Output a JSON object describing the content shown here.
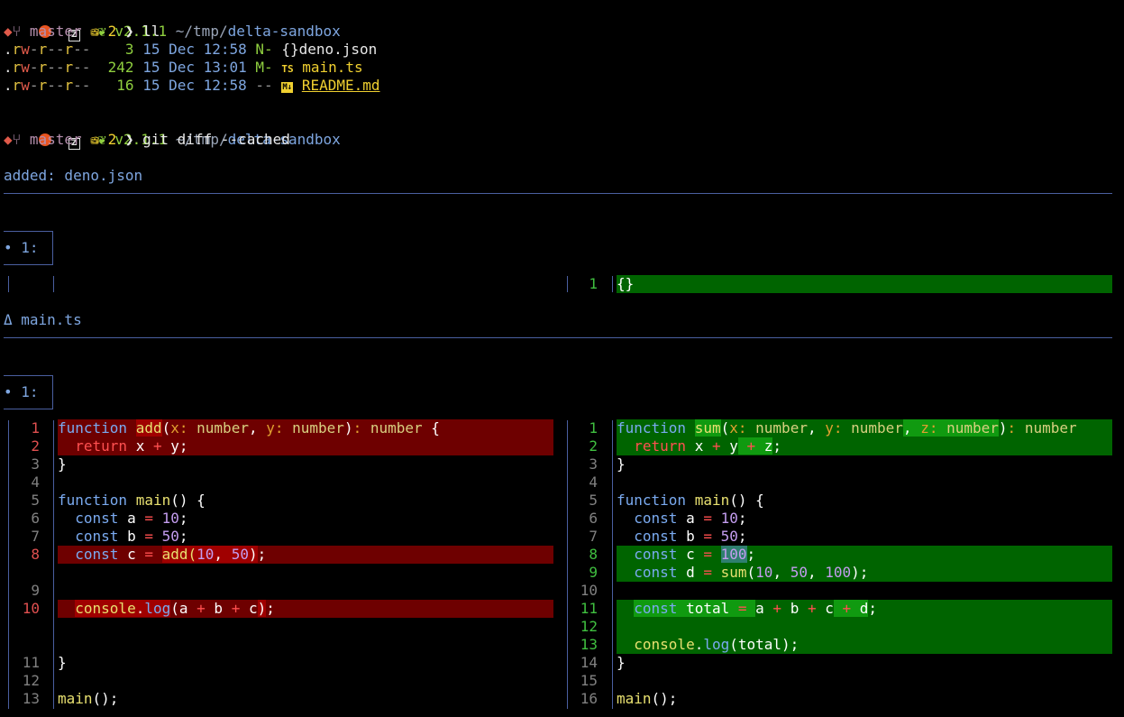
{
  "prompt": {
    "version": "v2.1.1",
    "path_prefix": "~/tmp/",
    "path_dir": "delta-sandbox",
    "branch": "master",
    "stash_count": "2",
    "symbol": "❯"
  },
  "commands": [
    "ll",
    "git diff --cached"
  ],
  "listing": [
    {
      "perm": ".rw-r--r--",
      "size": "3",
      "date": "15 Dec 12:58",
      "git": "N-",
      "icon": "{}",
      "name": "deno.json"
    },
    {
      "perm": ".rw-r--r--",
      "size": "242",
      "date": "15 Dec 13:01",
      "git": "M-",
      "icon": "TS",
      "name": "main.ts"
    },
    {
      "perm": ".rw-r--r--",
      "size": "16",
      "date": "15 Dec 12:58",
      "git": "--",
      "icon": "M↓",
      "name": "README.md"
    }
  ],
  "diff": {
    "file1_header": "added: deno.json",
    "file1_hunk": "• 1:",
    "file1_right_line": "1",
    "file1_right_code": "{}",
    "file2_header": "Δ main.ts",
    "file2_hunk": "• 1:",
    "left_line_numbers": [
      "1",
      "2",
      "3",
      "4",
      "5",
      "6",
      "7",
      "8",
      "",
      "9",
      "",
      "10",
      "",
      "",
      "11",
      "12",
      "13"
    ],
    "right_line_numbers": [
      "1",
      "2",
      "3",
      "4",
      "5",
      "6",
      "7",
      "8",
      "9",
      "10",
      "11",
      "12",
      "13",
      "14",
      "15",
      "16"
    ]
  },
  "colors": {
    "background": "#000000",
    "deleted_bg": "#6e0000",
    "added_bg": "#006400",
    "rule": "#4a5fa0"
  }
}
